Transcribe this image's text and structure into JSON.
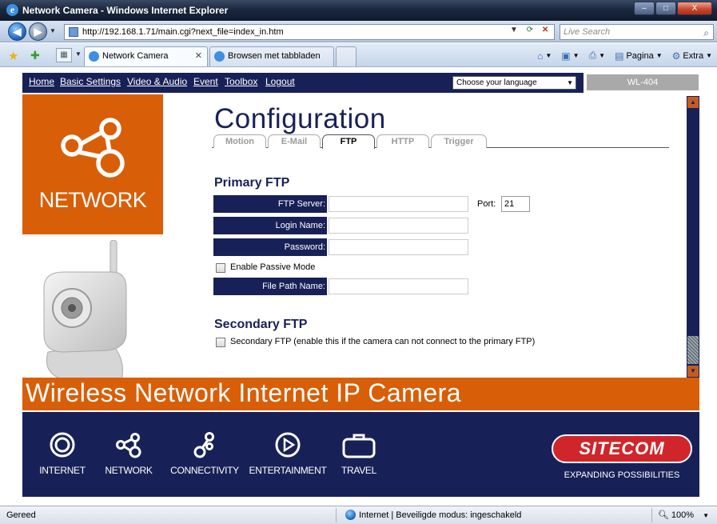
{
  "window": {
    "title": "Network Camera - Windows Internet Explorer",
    "buttons": [
      "–",
      "□",
      "X"
    ]
  },
  "address_bar": {
    "url": "http://192.168.1.71/main.cgi?next_file=index_in.htm",
    "search_placeholder": "Live Search"
  },
  "tabs": [
    {
      "label": "Network Camera",
      "active": true
    },
    {
      "label": "Browsen met tabbladen",
      "active": false
    }
  ],
  "command_bar": {
    "page_label": "Pagina",
    "extra_label": "Extra"
  },
  "site": {
    "nav": [
      "Home",
      "Basic Settings",
      "Video & Audio",
      "Event",
      "Toolbox",
      "Logout"
    ],
    "language_select": "Choose your language",
    "model": "WL-404",
    "brand_label": "NETWORK",
    "page_title": "Configuration",
    "config_tabs": [
      {
        "label": "Motion",
        "selected": false
      },
      {
        "label": "E-Mail",
        "selected": false
      },
      {
        "label": "FTP",
        "selected": true
      },
      {
        "label": "HTTP",
        "selected": false
      },
      {
        "label": "Trigger",
        "selected": false
      }
    ],
    "primary_ftp": {
      "heading": "Primary FTP",
      "server_label": "FTP Server:",
      "server_value": "",
      "port_label": "Port:",
      "port_value": "21",
      "login_label": "Login Name:",
      "login_value": "",
      "password_label": "Password:",
      "password_value": "",
      "passive_label": "Enable Passive Mode",
      "passive_checked": false,
      "path_label": "File Path Name:",
      "path_value": ""
    },
    "secondary_ftp": {
      "heading": "Secondary FTP",
      "checkbox_label": "Secondary FTP (enable this if the camera can not connect to the primary FTP)",
      "checked": false
    },
    "banner": "Wireless Network Internet IP Camera",
    "footer_items": [
      "INTERNET",
      "NETWORK",
      "CONNECTIVITY",
      "ENTERTAINMENT",
      "TRAVEL"
    ],
    "logo": "SITECOM",
    "tagline": "EXPANDING POSSIBILITIES"
  },
  "status_bar": {
    "left": "Gereed",
    "zone": "Internet | Beveiligde modus: ingeschakeld",
    "zoom": "100%"
  },
  "colors": {
    "navy": "#182157",
    "orange": "#d95e08",
    "sitecom_red": "#d0262b"
  }
}
